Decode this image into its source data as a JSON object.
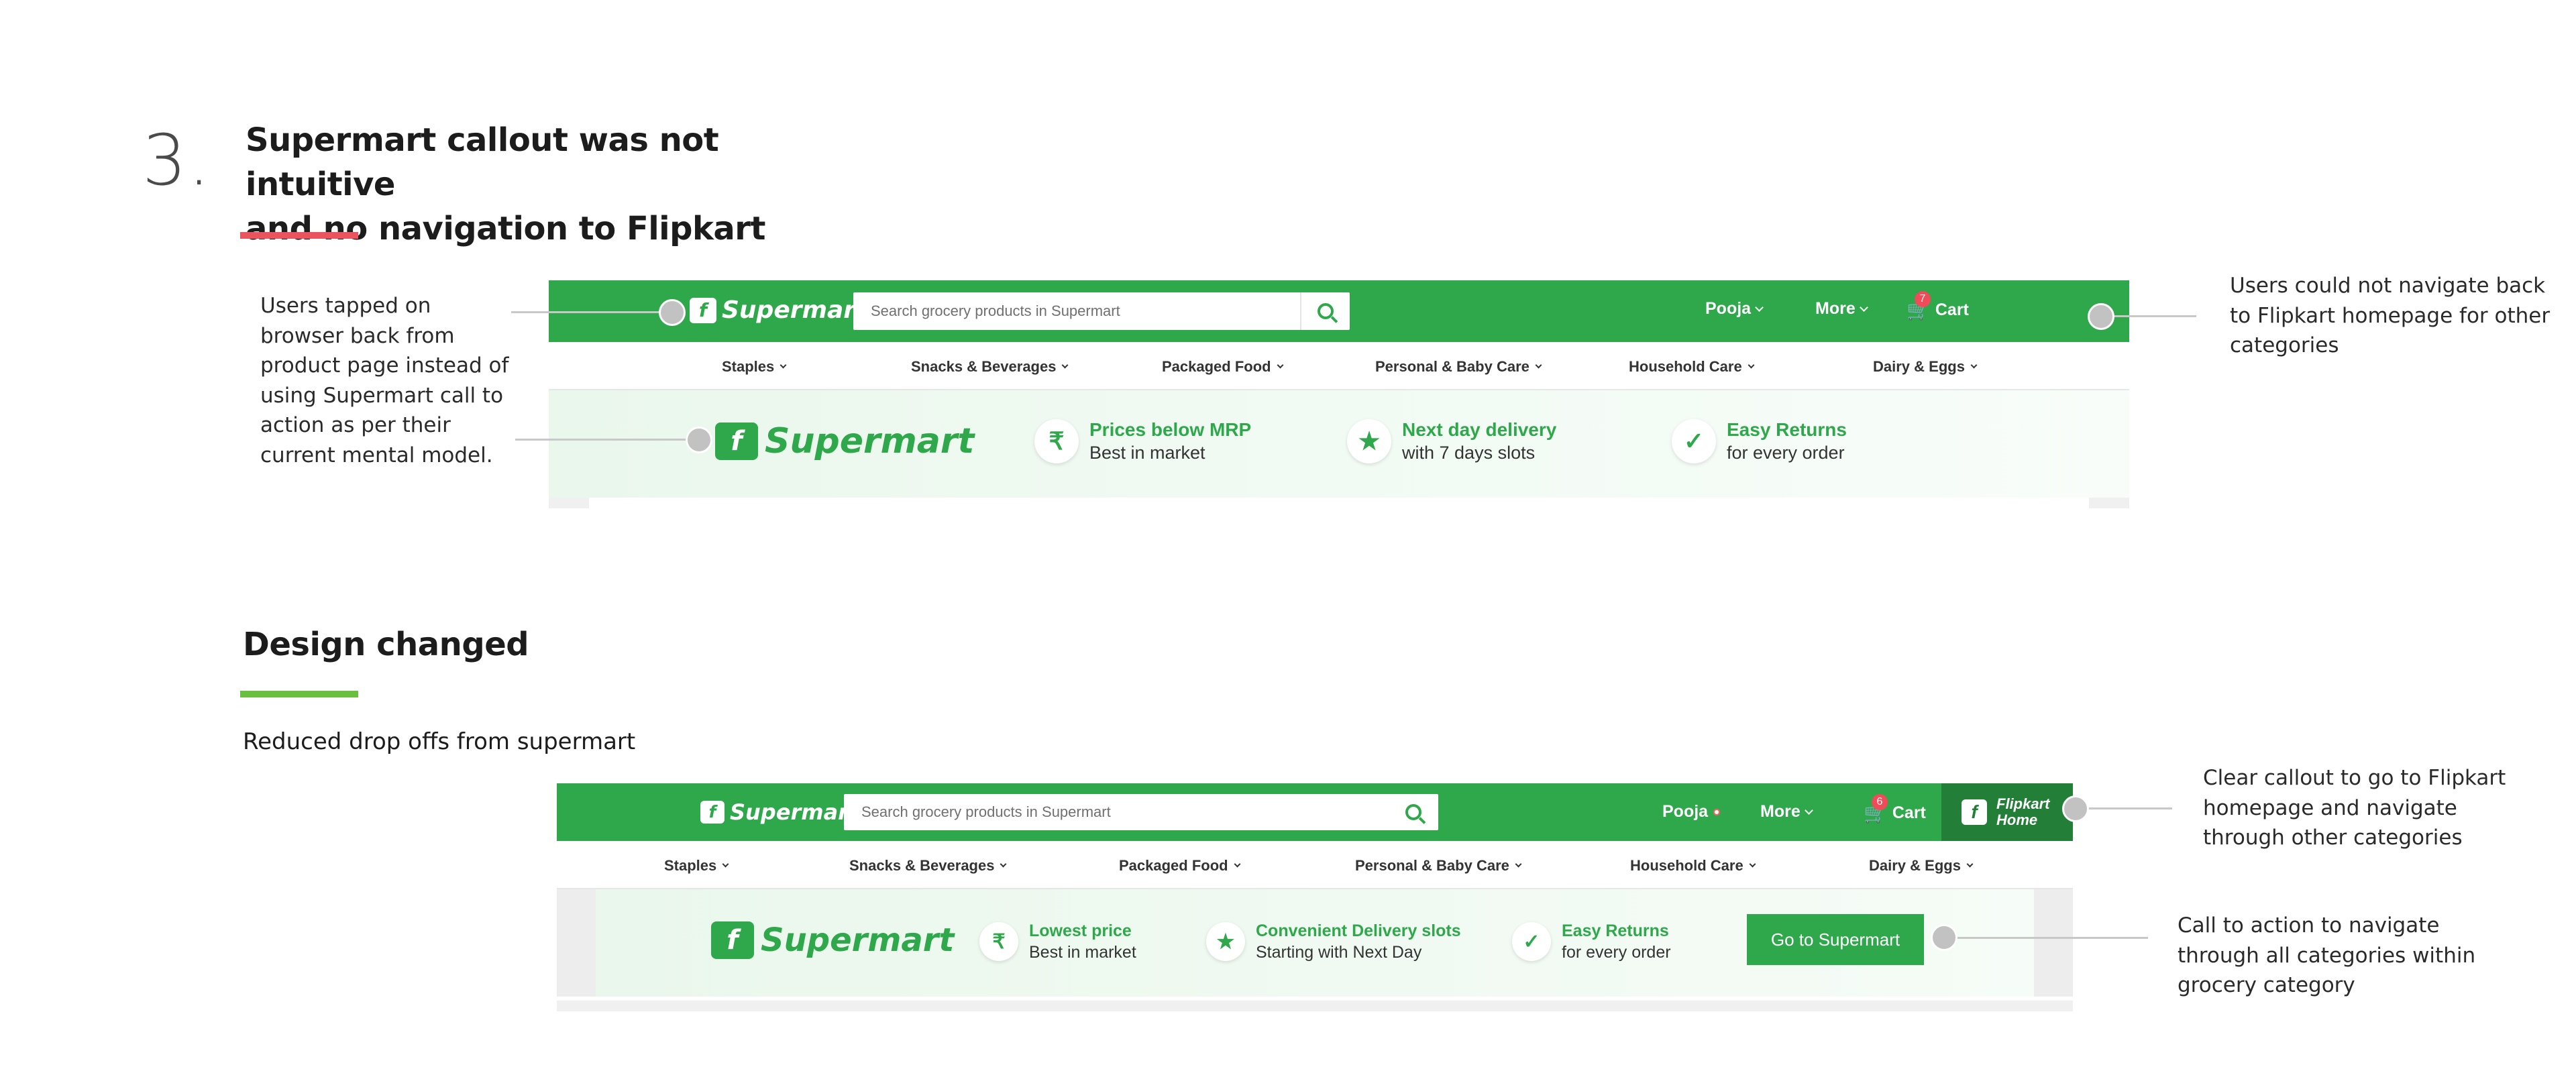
{
  "section1": {
    "number": "3.",
    "title_line1": "Supermart callout was not intuitive",
    "title_line2": "and no navigation to Flipkart",
    "note_left": "Users tapped on browser back from product page instead of using Supermart call to action as per their current mental model.",
    "note_right": "Users could not navigate back to Flipkart homepage for other categories",
    "screenshot": {
      "logo": "Supermart",
      "search_placeholder": "Search grocery products in Supermart",
      "user": "Pooja",
      "more": "More",
      "cart": "Cart",
      "cart_count": "7",
      "categories": [
        "Staples",
        "Snacks & Beverages",
        "Packaged Food",
        "Personal & Baby Care",
        "Household Care",
        "Dairy & Eggs"
      ],
      "banner_logo": "Supermart",
      "features": [
        {
          "icon": "rupee-icon",
          "glyph": "₹",
          "title": "Prices below MRP",
          "sub": "Best in market"
        },
        {
          "icon": "star-icon",
          "glyph": "★",
          "title": "Next day delivery",
          "sub": "with 7 days slots"
        },
        {
          "icon": "shield-check-icon",
          "glyph": "✓",
          "title": "Easy Returns",
          "sub": "for every order"
        }
      ]
    }
  },
  "section2": {
    "title": "Design changed",
    "subtitle": "Reduced drop offs from supermart",
    "note_top": "Clear callout to go to Flipkart homepage and navigate through other categories",
    "note_bottom": "Call to action to navigate through all categories within grocery category",
    "screenshot": {
      "logo": "Supermart",
      "search_placeholder": "Search grocery products in Supermart",
      "user": "Pooja",
      "more": "More",
      "cart": "Cart",
      "cart_count": "6",
      "flipkart_home": "Flipkart Home",
      "categories": [
        "Staples",
        "Snacks & Beverages",
        "Packaged Food",
        "Personal & Baby Care",
        "Household Care",
        "Dairy & Eggs"
      ],
      "banner_logo": "Supermart",
      "features": [
        {
          "icon": "rupee-icon",
          "glyph": "₹",
          "title": "Lowest price",
          "sub": "Best in market"
        },
        {
          "icon": "star-icon",
          "glyph": "★",
          "title": "Convenient Delivery slots",
          "sub": "Starting with Next Day"
        },
        {
          "icon": "shield-check-icon",
          "glyph": "✓",
          "title": "Easy Returns",
          "sub": "for every order"
        }
      ],
      "cta": "Go to Supermart"
    }
  },
  "colors": {
    "brand_green": "#2ea84a",
    "dark_green": "#237f38",
    "accent_red": "#e9545e",
    "accent_green": "#6abf3f",
    "badge_red": "#ef4b58"
  }
}
